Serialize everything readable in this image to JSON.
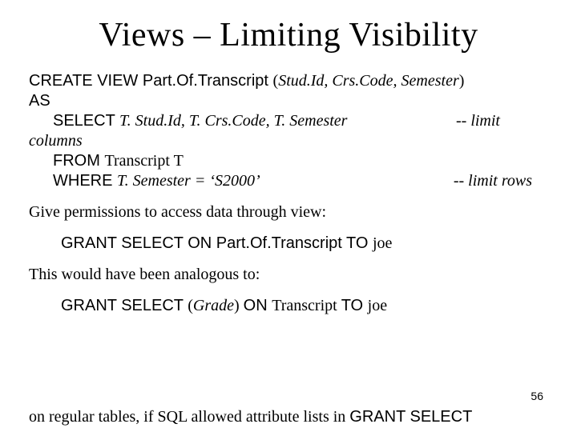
{
  "title": "Views – Limiting Visibility",
  "code": {
    "kw_create": "CREATE  VIEW ",
    "view_name": "Part.Of.Transcript ",
    "sig_open": "(",
    "sig_args": "Stud.Id, Crs.Code, Semester",
    "sig_close": ")",
    "kw_as": "AS",
    "kw_select": "SELECT  ",
    "select_cols": "T. Stud.Id, T. Crs.Code, T. Semester",
    "cmt_cols": "-- limit",
    "columns_word": "columns",
    "kw_from": "FROM  ",
    "from_tbl": "Transcript ",
    "from_alias": "T",
    "kw_where": "WHERE  ",
    "where_pred": "T. Semester = ‘S2000’",
    "cmt_rows": "-- limit rows"
  },
  "line_perm_intro": "Give permissions to access data through view:",
  "grant1": {
    "kw_grant": "GRANT  SELECT  ON  ",
    "obj": "Part.Of.Transcript  ",
    "kw_to": "TO  ",
    "user": "joe"
  },
  "line_analog_intro": "This would have been analogous to:",
  "grant2": {
    "kw_grant": "GRANT  SELECT  ",
    "open": "(",
    "col": "Grade",
    "close": ") ",
    "kw_on": "ON  ",
    "obj": "Transcript  ",
    "kw_to": "TO  ",
    "user": "joe"
  },
  "footer_a": "on regular tables, if SQL allowed attribute lists in ",
  "footer_b": "GRANT  SELECT",
  "page": "56"
}
